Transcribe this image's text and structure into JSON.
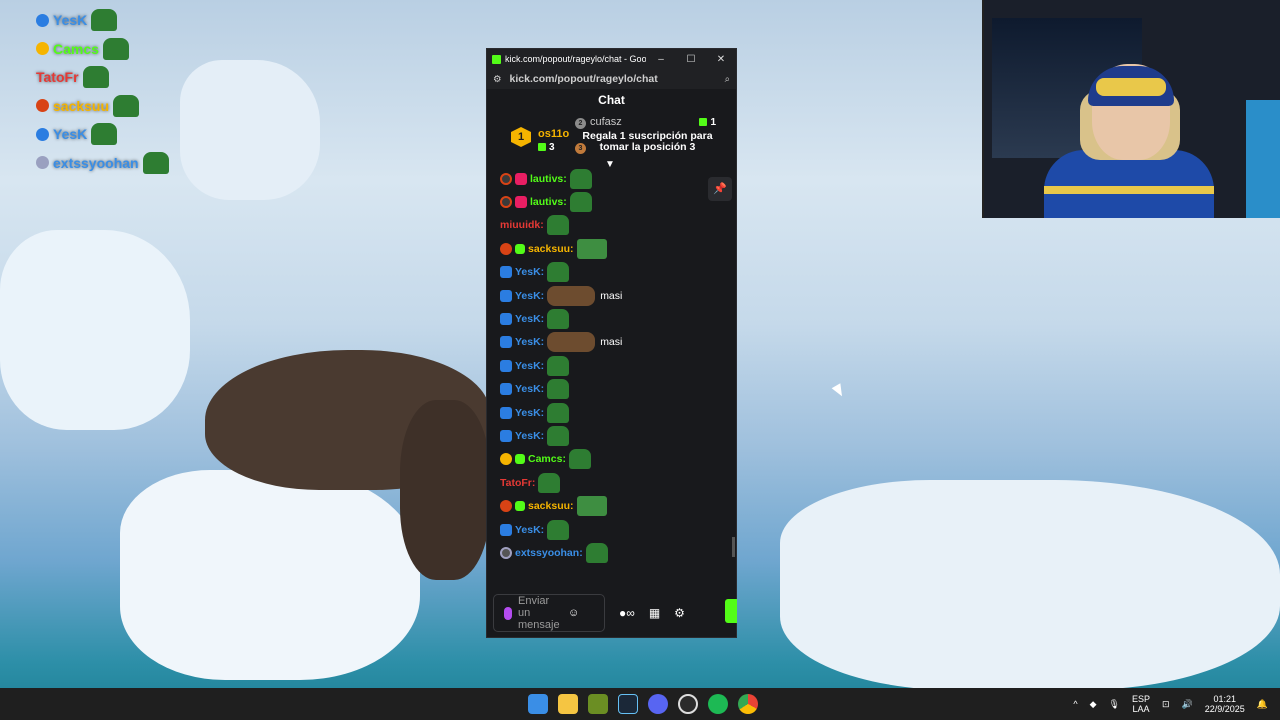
{
  "overlay": [
    {
      "name": "YesK",
      "color": "#3a8ee6",
      "badge": "#2b7de1"
    },
    {
      "name": "Camcs",
      "color": "#53fc18",
      "badge": "#f5b400"
    },
    {
      "name": "TatoFr",
      "color": "#e53935",
      "badge": ""
    },
    {
      "name": "sacksuu",
      "color": "#f5b400",
      "badge": "#d84315"
    },
    {
      "name": "YesK",
      "color": "#3a8ee6",
      "badge": "#2b7de1"
    },
    {
      "name": "extssyoohan",
      "color": "#3a8ee6",
      "badge": "#9aa0c0"
    }
  ],
  "window": {
    "title": "kick.com/popout/rageylo/chat - Googl...",
    "url": "kick.com/popout/rageylo/chat",
    "minimize": "–",
    "maximize": "☐",
    "close": "✕"
  },
  "chat": {
    "header": "Chat",
    "leaderboard": {
      "first_rank": "1",
      "first_name": "os11o",
      "first_count": "3",
      "second_rank": "2",
      "second_name": "cufasz",
      "second_count": "1",
      "third_rank": "3",
      "promo": "Regala 1 suscripción para tomar la posición 3"
    },
    "messages": [
      {
        "user": "lautivs:",
        "color": "#53fc18",
        "badges": [
          "dark",
          "pink"
        ],
        "emote": "frog",
        "text": ""
      },
      {
        "user": "lautivs:",
        "color": "#53fc18",
        "badges": [
          "dark",
          "pink"
        ],
        "emote": "frog",
        "text": ""
      },
      {
        "user": "miuuidk:",
        "color": "#e53935",
        "badges": [],
        "emote": "frog",
        "text": ""
      },
      {
        "user": "sacksuu:",
        "color": "#f5b400",
        "badges": [
          "red",
          "sub"
        ],
        "emote": "tv",
        "text": ""
      },
      {
        "user": "YesK:",
        "color": "#3a8ee6",
        "badges": [
          "vip"
        ],
        "emote": "frog",
        "text": ""
      },
      {
        "user": "YesK:",
        "color": "#3a8ee6",
        "badges": [
          "vip"
        ],
        "emote": "face",
        "text": "masi"
      },
      {
        "user": "YesK:",
        "color": "#3a8ee6",
        "badges": [
          "vip"
        ],
        "emote": "frog",
        "text": ""
      },
      {
        "user": "YesK:",
        "color": "#3a8ee6",
        "badges": [
          "vip"
        ],
        "emote": "face",
        "text": "masi"
      },
      {
        "user": "YesK:",
        "color": "#3a8ee6",
        "badges": [
          "vip"
        ],
        "emote": "frog",
        "text": ""
      },
      {
        "user": "YesK:",
        "color": "#3a8ee6",
        "badges": [
          "vip"
        ],
        "emote": "frog",
        "text": ""
      },
      {
        "user": "YesK:",
        "color": "#3a8ee6",
        "badges": [
          "vip"
        ],
        "emote": "frog",
        "text": ""
      },
      {
        "user": "YesK:",
        "color": "#3a8ee6",
        "badges": [
          "vip"
        ],
        "emote": "frog",
        "text": ""
      },
      {
        "user": "Camcs:",
        "color": "#53fc18",
        "badges": [
          "gold",
          "sub"
        ],
        "emote": "frog",
        "text": ""
      },
      {
        "user": "TatoFr:",
        "color": "#e53935",
        "badges": [],
        "emote": "frog",
        "text": ""
      },
      {
        "user": "sacksuu:",
        "color": "#f5b400",
        "badges": [
          "red",
          "sub"
        ],
        "emote": "tv",
        "text": ""
      },
      {
        "user": "YesK:",
        "color": "#3a8ee6",
        "badges": [
          "vip"
        ],
        "emote": "frog",
        "text": ""
      },
      {
        "user": "extssyoohan:",
        "color": "#3a8ee6",
        "badges": [
          "gray"
        ],
        "emote": "frog",
        "text": ""
      }
    ],
    "input_placeholder": "Enviar un mensaje"
  },
  "taskbar": {
    "lang_top": "ESP",
    "lang_bottom": "LAA",
    "time": "01:21",
    "date": "22/9/2025"
  }
}
